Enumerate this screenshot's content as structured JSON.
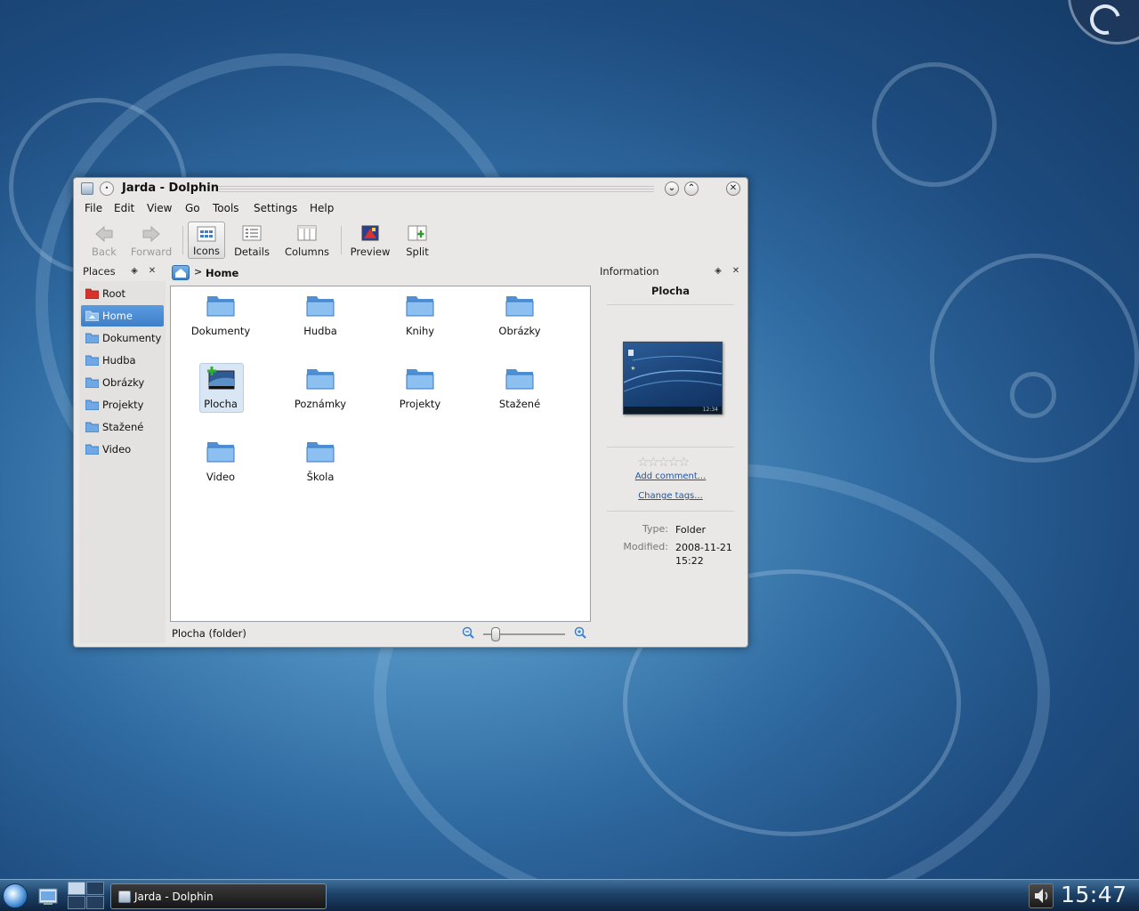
{
  "window": {
    "title": "Jarda - Dolphin",
    "pin_symbol": "•",
    "minimize_symbol": "⌄",
    "maximize_symbol": "⌃",
    "close_symbol": "✕"
  },
  "menu": [
    "File",
    "Edit",
    "View",
    "Go",
    "Tools",
    "Settings",
    "Help"
  ],
  "toolbar": {
    "back": "Back",
    "forward": "Forward",
    "icons": "Icons",
    "details": "Details",
    "columns": "Columns",
    "preview": "Preview",
    "split": "Split"
  },
  "places": {
    "title": "Places",
    "items": [
      {
        "label": "Root",
        "icon": "red-folder-icon"
      },
      {
        "label": "Home",
        "icon": "home-folder-icon",
        "selected": true
      },
      {
        "label": "Dokumenty",
        "icon": "folder-icon"
      },
      {
        "label": "Hudba",
        "icon": "folder-icon"
      },
      {
        "label": "Obrázky",
        "icon": "folder-icon"
      },
      {
        "label": "Projekty",
        "icon": "folder-icon"
      },
      {
        "label": "Stažené",
        "icon": "folder-icon"
      },
      {
        "label": "Video",
        "icon": "folder-icon"
      }
    ]
  },
  "breadcrumb": {
    "separator": ">",
    "current": "Home"
  },
  "files": [
    {
      "name": "Dokumenty"
    },
    {
      "name": "Hudba"
    },
    {
      "name": "Knihy"
    },
    {
      "name": "Obrázky"
    },
    {
      "name": "Plocha",
      "selected": true,
      "icon": "desktop-folder-icon"
    },
    {
      "name": "Poznámky"
    },
    {
      "name": "Projekty"
    },
    {
      "name": "Stažené"
    },
    {
      "name": "Video"
    },
    {
      "name": "Škola"
    }
  ],
  "status": {
    "text": "Plocha (folder)"
  },
  "info": {
    "title": "Information",
    "name": "Plocha",
    "preview_clock": "12:34",
    "rating": 0,
    "rating_max": 5,
    "add_comment": "Add comment...",
    "change_tags": "Change tags...",
    "type_label": "Type:",
    "type_value": "Folder",
    "modified_label": "Modified:",
    "modified_value": "2008-11-21 15:22"
  },
  "taskbar": {
    "task_label": "Jarda - Dolphin",
    "clock": "15:47"
  },
  "colors": {
    "accent": "#3f7fc9",
    "folder": "#5a9be0",
    "link": "#1d55a8"
  }
}
